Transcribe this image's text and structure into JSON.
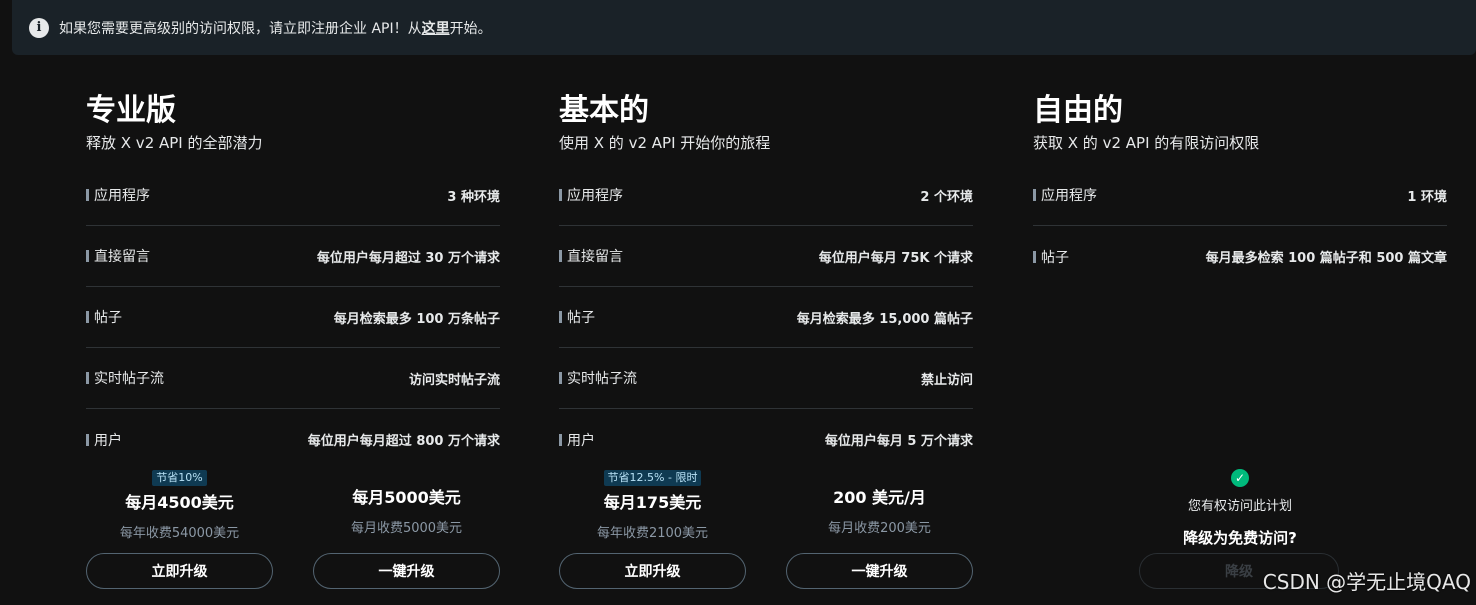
{
  "banner": {
    "text_before": "如果您需要更高级别的访问权限，请立即注册企业 API！从",
    "link": "这里",
    "text_after": "开始。"
  },
  "plans": [
    {
      "title": "专业版",
      "subtitle": "释放 X v2 API 的全部潜力",
      "features": [
        {
          "name": "应用程序",
          "value": "3 种环境"
        },
        {
          "name": "直接留言",
          "value": "每位用户每月超过 30 万个请求"
        },
        {
          "name": "帖子",
          "value": "每月检索最多 100 万条帖子"
        },
        {
          "name": "实时帖子流",
          "value": "访问实时帖子流"
        },
        {
          "name": "用户",
          "value": "每位用户每月超过 800 万个请求"
        }
      ],
      "yearly_option": {
        "badge": "节省10%",
        "price": "每月4500美元",
        "billing": "每年收费54000美元",
        "button": "立即升级"
      },
      "monthly_option": {
        "price": "每月5000美元",
        "billing": "每月收费5000美元",
        "button": "一键升级"
      }
    },
    {
      "title": "基本的",
      "subtitle": "使用 X 的 v2 API 开始你的旅程",
      "features": [
        {
          "name": "应用程序",
          "value": "2 个环境"
        },
        {
          "name": "直接留言",
          "value": "每位用户每月 75K 个请求"
        },
        {
          "name": "帖子",
          "value": "每月检索最多 15,000 篇帖子"
        },
        {
          "name": "实时帖子流",
          "value": "禁止访问"
        },
        {
          "name": "用户",
          "value": "每位用户每月 5 万个请求"
        }
      ],
      "yearly_option": {
        "badge": "节省12.5% - 限时",
        "price": "每月175美元",
        "billing": "每年收费2100美元",
        "button": "立即升级"
      },
      "monthly_option": {
        "price": "200 美元/月",
        "billing": "每月收费200美元",
        "button": "一键升级"
      }
    },
    {
      "title": "自由的",
      "subtitle": "获取 X 的 v2 API 的有限访问权限",
      "features": [
        {
          "name": "应用程序",
          "value": "1 环境"
        },
        {
          "name": "帖子",
          "value": "每月最多检索 100 篇帖子和 500 篇文章"
        }
      ],
      "status": "您有权访问此计划",
      "downgrade_question": "降级为免费访问?",
      "downgrade_button": "降级"
    }
  ],
  "watermark": "CSDN @学无止境QAQ",
  "colors": {
    "background": "#111111",
    "banner": "#1a2228",
    "badge": "#0f3a52",
    "check": "#00ba7c"
  }
}
